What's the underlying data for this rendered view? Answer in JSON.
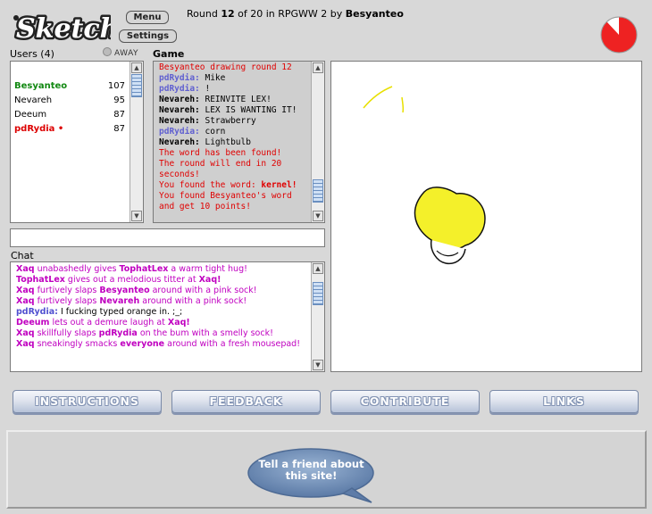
{
  "header": {
    "logo_text": "Sketch",
    "menu_label": "Menu",
    "settings_label": "Settings",
    "round_prefix": "Round ",
    "round_current": "12",
    "round_mid": " of 20 in RPGWW 2 by ",
    "round_artist": "Besyanteo"
  },
  "users": {
    "label": "Users (4)",
    "away_label": "AWAY",
    "list": [
      {
        "name": "Besyanteo",
        "score": "107",
        "color": "#118811",
        "bold": true
      },
      {
        "name": "Nevareh",
        "score": "95",
        "color": "#000000",
        "bold": false
      },
      {
        "name": "Deeum",
        "score": "87",
        "color": "#000000",
        "bold": false
      },
      {
        "name": "pdRydia •",
        "score": "87",
        "color": "#dd0000",
        "bold": true
      }
    ]
  },
  "game": {
    "label": "Game",
    "log": [
      {
        "kind": "red",
        "text": "Besyanteo drawing round 12"
      },
      {
        "kind": "blue",
        "name": "pdRydia:",
        "text": " Mike"
      },
      {
        "kind": "blue",
        "name": "pdRydia:",
        "text": " !"
      },
      {
        "kind": "black",
        "name": "Nevareh:",
        "text": " REINVITE LEX!"
      },
      {
        "kind": "black",
        "name": "Nevareh:",
        "text": " LEX IS WANTING IT!"
      },
      {
        "kind": "black",
        "name": "Nevareh:",
        "text": " Strawberry"
      },
      {
        "kind": "blue",
        "name": "pdRydia:",
        "text": " corn"
      },
      {
        "kind": "black",
        "name": "Nevareh:",
        "text": " Lightbulb"
      },
      {
        "kind": "red",
        "text": "The word has been found!"
      },
      {
        "kind": "red",
        "text": "The round will end in 20 seconds!"
      },
      {
        "kind": "red-word",
        "text": "You found the word: ",
        "word": "kernel!"
      },
      {
        "kind": "red",
        "text": "You found Besyanteo's word and get 10 points!"
      }
    ]
  },
  "chat": {
    "label": "Chat",
    "input_value": "",
    "log": [
      {
        "parts": [
          [
            "n",
            "Xaq"
          ],
          [
            "t",
            " unabashedly gives "
          ],
          [
            "n",
            "TophatLex"
          ],
          [
            "t",
            " a warm tight hug!"
          ]
        ]
      },
      {
        "parts": [
          [
            "n",
            "TophatLex"
          ],
          [
            "t",
            " gives out a melodious titter at "
          ],
          [
            "n",
            "Xaq!"
          ]
        ]
      },
      {
        "parts": [
          [
            "n",
            "Xaq"
          ],
          [
            "t",
            " furtively slaps "
          ],
          [
            "n",
            "Besyanteo"
          ],
          [
            "t",
            " around with a pink sock!"
          ]
        ]
      },
      {
        "parts": [
          [
            "n",
            "Xaq"
          ],
          [
            "t",
            " furtively slaps "
          ],
          [
            "n",
            "Nevareh"
          ],
          [
            "t",
            " around with a pink sock!"
          ]
        ]
      },
      {
        "blue": true,
        "parts": [
          [
            "n",
            "pdRydia:"
          ],
          [
            "t",
            " I fucking typed orange in. ;_;"
          ]
        ]
      },
      {
        "parts": [
          [
            "n",
            "Deeum"
          ],
          [
            "t",
            " lets out a demure laugh at "
          ],
          [
            "n",
            "Xaq!"
          ]
        ]
      },
      {
        "parts": [
          [
            "n",
            "Xaq"
          ],
          [
            "t",
            " skillfully slaps "
          ],
          [
            "n",
            "pdRydia"
          ],
          [
            "t",
            " on the bum with a smelly sock!"
          ]
        ]
      },
      {
        "parts": [
          [
            "n",
            "Xaq"
          ],
          [
            "t",
            " sneakingly smacks "
          ],
          [
            "n",
            "everyone"
          ],
          [
            "t",
            " around with a fresh mousepad!"
          ]
        ]
      }
    ]
  },
  "nav": {
    "instructions": "INSTRUCTIONS",
    "feedback": "FEEDBACK",
    "contribute": "CONTRIBUTE",
    "links": "LINKS"
  },
  "footer": {
    "tell_friend_line1": "Tell a friend about",
    "tell_friend_line2": "this site!"
  },
  "timer": {
    "remaining_fraction": 0.88,
    "color": "#ee2222"
  },
  "colors": {
    "chat_name": "#c000c0",
    "game_red": "#e00000",
    "game_blue": "#6060d0"
  }
}
